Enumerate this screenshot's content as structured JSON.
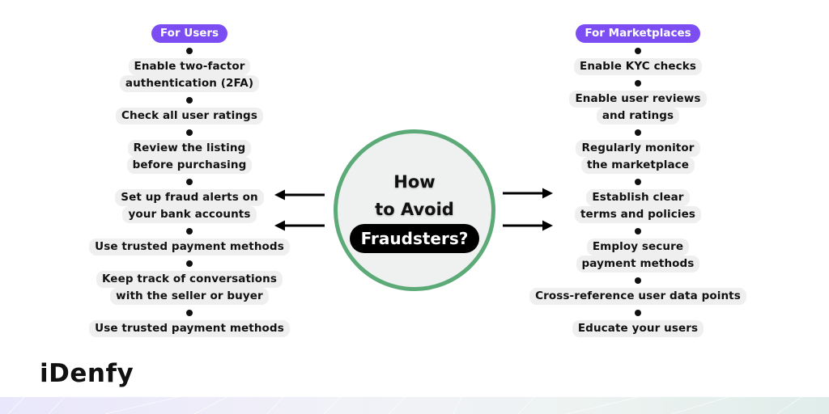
{
  "left": {
    "header": "For Users",
    "items": [
      [
        "Enable two-factor",
        "authentication (2FA)"
      ],
      [
        "Check all user ratings"
      ],
      [
        "Review the listing",
        "before purchasing"
      ],
      [
        "Set up fraud alerts on",
        "your bank accounts"
      ],
      [
        "Use trusted payment methods"
      ],
      [
        "Keep track of conversations",
        "with the seller or buyer"
      ],
      [
        "Use trusted payment methods"
      ]
    ]
  },
  "right": {
    "header": "For Marketplaces",
    "items": [
      [
        "Enable KYC checks"
      ],
      [
        "Enable user reviews",
        "and ratings"
      ],
      [
        "Regularly monitor",
        "the marketplace"
      ],
      [
        "Establish clear",
        "terms and policies"
      ],
      [
        "Employ secure",
        "payment methods"
      ],
      [
        "Cross-reference user data points"
      ],
      [
        "Educate your users"
      ]
    ]
  },
  "center": {
    "line1": "How",
    "line2": "to Avoid",
    "highlight": "Fraudsters?"
  },
  "arrows": {
    "left": [
      "arrow-left-icon",
      "arrow-left-icon"
    ],
    "right": [
      "arrow-right-icon",
      "arrow-right-icon"
    ]
  },
  "brand": {
    "logo_text": "iDenfy"
  },
  "colors": {
    "accent_purple": "#7B4DF2",
    "circle_border_green": "#5BAA78",
    "item_background": "#EFEFEF",
    "circle_fill": "#EFF0F0"
  }
}
